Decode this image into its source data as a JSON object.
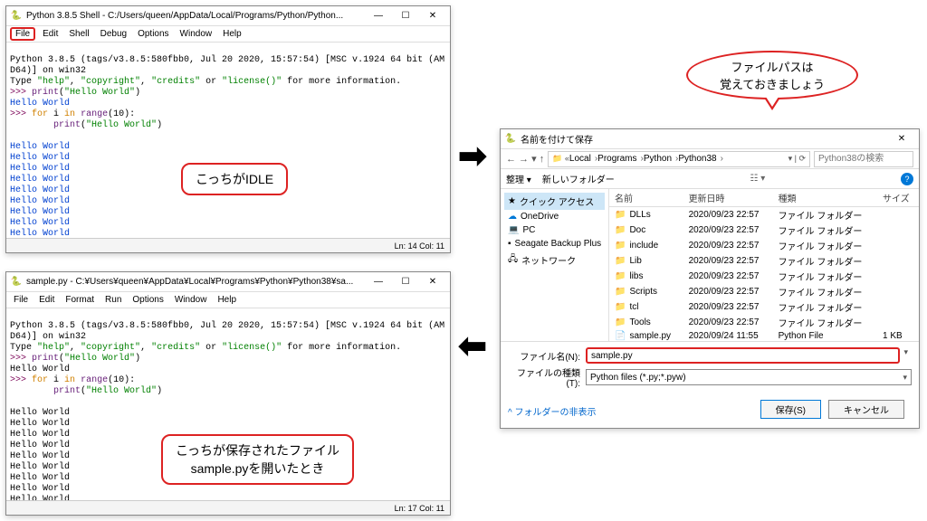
{
  "idle": {
    "title": "Python 3.8.5 Shell - C:/Users/queen/AppData/Local/Programs/Python/Python...",
    "menu": [
      "File",
      "Edit",
      "Shell",
      "Debug",
      "Options",
      "Window",
      "Help"
    ],
    "banner1": "Python 3.8.5 (tags/v3.8.5:580fbb0, Jul 20 2020, 15:57:54) [MSC v.1924 64 bit (AM",
    "banner2": "D64)] on win32",
    "banner3_a": "Type ",
    "banner3_b": "\"help\"",
    "banner3_c": ", ",
    "banner3_d": "\"copyright\"",
    "banner3_e": ", ",
    "banner3_f": "\"credits\"",
    "banner3_g": " or ",
    "banner3_h": "\"license()\"",
    "banner3_i": " for more information.",
    "p1_prompt": ">>> ",
    "p1_fn": "print",
    "p1_open": "(",
    "p1_str": "\"Hello World\"",
    "p1_close": ")",
    "out1": "Hello World",
    "p2_prompt": ">>> ",
    "p2_for": "for",
    "p2_mid": " i ",
    "p2_in": "in",
    "p2_rng": " range",
    "p2_arg": "(10):",
    "p2_indent": "        ",
    "p2_fn": "print",
    "p2_open": "(",
    "p2_str": "\"Hello World\"",
    "p2_close": ")",
    "loop_out": "Hello World",
    "final_prompt": ">>> ",
    "status": "Ln: 14  Col: 11"
  },
  "editor": {
    "title": "sample.py - C:¥Users¥queen¥AppData¥Local¥Programs¥Python¥Python38¥sa...",
    "menu": [
      "File",
      "Edit",
      "Format",
      "Run",
      "Options",
      "Window",
      "Help"
    ],
    "status": "Ln: 17  Col: 11"
  },
  "save": {
    "title": "名前を付けて保存",
    "crumbs": [
      "Local",
      "Programs",
      "Python",
      "Python38"
    ],
    "search_ph": "Python38の検索",
    "organize": "整理 ▾",
    "newfolder": "新しいフォルダー",
    "nav": {
      "quick": "クイック アクセス",
      "onedrive": "OneDrive",
      "pc": "PC",
      "seagate": "Seagate Backup Plus",
      "network": "ネットワーク"
    },
    "cols": {
      "name": "名前",
      "date": "更新日時",
      "type": "種類",
      "size": "サイズ"
    },
    "rows": [
      {
        "n": "DLLs",
        "d": "2020/09/23 22:57",
        "t": "ファイル フォルダー",
        "s": ""
      },
      {
        "n": "Doc",
        "d": "2020/09/23 22:57",
        "t": "ファイル フォルダー",
        "s": ""
      },
      {
        "n": "include",
        "d": "2020/09/23 22:57",
        "t": "ファイル フォルダー",
        "s": ""
      },
      {
        "n": "Lib",
        "d": "2020/09/23 22:57",
        "t": "ファイル フォルダー",
        "s": ""
      },
      {
        "n": "libs",
        "d": "2020/09/23 22:57",
        "t": "ファイル フォルダー",
        "s": ""
      },
      {
        "n": "Scripts",
        "d": "2020/09/23 22:57",
        "t": "ファイル フォルダー",
        "s": ""
      },
      {
        "n": "tcl",
        "d": "2020/09/23 22:57",
        "t": "ファイル フォルダー",
        "s": ""
      },
      {
        "n": "Tools",
        "d": "2020/09/23 22:57",
        "t": "ファイル フォルダー",
        "s": ""
      },
      {
        "n": "sample.py",
        "d": "2020/09/24 11:55",
        "t": "Python File",
        "s": "1 KB"
      }
    ],
    "fname_label": "ファイル名(N):",
    "fname_value": "sample.py",
    "ftype_label": "ファイルの種類(T):",
    "ftype_value": "Python files (*.py;*.pyw)",
    "hide_folders": "^ フォルダーの非表示",
    "save_btn": "保存(S)",
    "cancel_btn": "キャンセル"
  },
  "callouts": {
    "idle": "こっちがIDLE",
    "path1": "ファイルパスは",
    "path2": "覚えておきましょう",
    "editor1": "こっちが保存されたファイル",
    "editor2": "sample.pyを開いたとき"
  }
}
